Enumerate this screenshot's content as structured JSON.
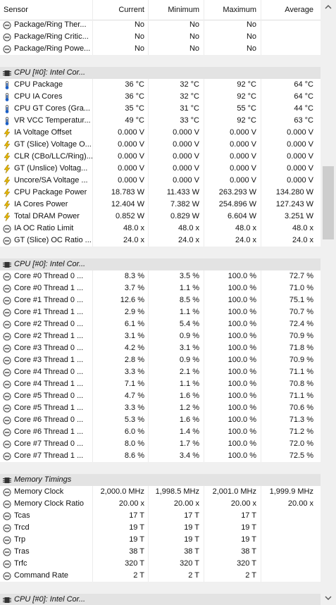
{
  "header": {
    "sensor": "Sensor",
    "current": "Current",
    "minimum": "Minimum",
    "maximum": "Maximum",
    "average": "Average"
  },
  "colors": {
    "section_bg": "#e3e3e3",
    "bolt": "#e8b800",
    "thermo": "#1a5fc8"
  },
  "rows": [
    {
      "type": "data",
      "icon": "circle",
      "name": "Package/Ring Ther...",
      "cur": "No",
      "min": "No",
      "max": "No",
      "avg": ""
    },
    {
      "type": "data",
      "icon": "circle",
      "name": "Package/Ring Critic...",
      "cur": "No",
      "min": "No",
      "max": "No",
      "avg": ""
    },
    {
      "type": "data",
      "icon": "circle",
      "name": "Package/Ring Powe...",
      "cur": "No",
      "min": "No",
      "max": "No",
      "avg": ""
    },
    {
      "type": "blank"
    },
    {
      "type": "section",
      "icon": "chip",
      "name": "CPU [#0]: Intel Cor..."
    },
    {
      "type": "data",
      "icon": "thermo",
      "name": "CPU Package",
      "cur": "36 °C",
      "min": "32 °C",
      "max": "92 °C",
      "avg": "64 °C"
    },
    {
      "type": "data",
      "icon": "thermo",
      "name": "CPU IA Cores",
      "cur": "36 °C",
      "min": "32 °C",
      "max": "92 °C",
      "avg": "64 °C"
    },
    {
      "type": "data",
      "icon": "thermo",
      "name": "CPU GT Cores (Gra...",
      "cur": "35 °C",
      "min": "31 °C",
      "max": "55 °C",
      "avg": "44 °C"
    },
    {
      "type": "data",
      "icon": "thermo",
      "name": "VR VCC Temperatur...",
      "cur": "49 °C",
      "min": "33 °C",
      "max": "92 °C",
      "avg": "63 °C"
    },
    {
      "type": "data",
      "icon": "bolt",
      "name": "IA Voltage Offset",
      "cur": "0.000 V",
      "min": "0.000 V",
      "max": "0.000 V",
      "avg": "0.000 V"
    },
    {
      "type": "data",
      "icon": "bolt",
      "name": "GT (Slice) Voltage O...",
      "cur": "0.000 V",
      "min": "0.000 V",
      "max": "0.000 V",
      "avg": "0.000 V"
    },
    {
      "type": "data",
      "icon": "bolt",
      "name": "CLR (CBo/LLC/Ring)...",
      "cur": "0.000 V",
      "min": "0.000 V",
      "max": "0.000 V",
      "avg": "0.000 V"
    },
    {
      "type": "data",
      "icon": "bolt",
      "name": "GT (Unslice) Voltag...",
      "cur": "0.000 V",
      "min": "0.000 V",
      "max": "0.000 V",
      "avg": "0.000 V"
    },
    {
      "type": "data",
      "icon": "bolt",
      "name": "Uncore/SA Voltage ...",
      "cur": "0.000 V",
      "min": "0.000 V",
      "max": "0.000 V",
      "avg": "0.000 V"
    },
    {
      "type": "data",
      "icon": "bolt",
      "name": "CPU Package Power",
      "cur": "18.783 W",
      "min": "11.433 W",
      "max": "263.293 W",
      "avg": "134.280 W"
    },
    {
      "type": "data",
      "icon": "bolt",
      "name": "IA Cores Power",
      "cur": "12.404 W",
      "min": "7.382 W",
      "max": "254.896 W",
      "avg": "127.243 W"
    },
    {
      "type": "data",
      "icon": "bolt",
      "name": "Total DRAM Power",
      "cur": "0.852 W",
      "min": "0.829 W",
      "max": "6.604 W",
      "avg": "3.251 W"
    },
    {
      "type": "data",
      "icon": "circle",
      "name": "IA OC Ratio Limit",
      "cur": "48.0 x",
      "min": "48.0 x",
      "max": "48.0 x",
      "avg": "48.0 x"
    },
    {
      "type": "data",
      "icon": "circle",
      "name": "GT (Slice) OC Ratio ...",
      "cur": "24.0 x",
      "min": "24.0 x",
      "max": "24.0 x",
      "avg": "24.0 x"
    },
    {
      "type": "blank"
    },
    {
      "type": "section",
      "icon": "chip",
      "name": "CPU [#0]: Intel Cor..."
    },
    {
      "type": "data",
      "icon": "circle",
      "name": "Core #0 Thread 0 ...",
      "cur": "8.3 %",
      "min": "3.5 %",
      "max": "100.0 %",
      "avg": "72.7 %"
    },
    {
      "type": "data",
      "icon": "circle",
      "name": "Core #0 Thread 1 ...",
      "cur": "3.7 %",
      "min": "1.1 %",
      "max": "100.0 %",
      "avg": "71.0 %"
    },
    {
      "type": "data",
      "icon": "circle",
      "name": "Core #1 Thread 0 ...",
      "cur": "12.6 %",
      "min": "8.5 %",
      "max": "100.0 %",
      "avg": "75.1 %"
    },
    {
      "type": "data",
      "icon": "circle",
      "name": "Core #1 Thread 1 ...",
      "cur": "2.9 %",
      "min": "1.1 %",
      "max": "100.0 %",
      "avg": "70.7 %"
    },
    {
      "type": "data",
      "icon": "circle",
      "name": "Core #2 Thread 0 ...",
      "cur": "6.1 %",
      "min": "5.4 %",
      "max": "100.0 %",
      "avg": "72.4 %"
    },
    {
      "type": "data",
      "icon": "circle",
      "name": "Core #2 Thread 1 ...",
      "cur": "3.1 %",
      "min": "0.9 %",
      "max": "100.0 %",
      "avg": "70.9 %"
    },
    {
      "type": "data",
      "icon": "circle",
      "name": "Core #3 Thread 0 ...",
      "cur": "4.2 %",
      "min": "3.1 %",
      "max": "100.0 %",
      "avg": "71.8 %"
    },
    {
      "type": "data",
      "icon": "circle",
      "name": "Core #3 Thread 1 ...",
      "cur": "2.8 %",
      "min": "0.9 %",
      "max": "100.0 %",
      "avg": "70.9 %"
    },
    {
      "type": "data",
      "icon": "circle",
      "name": "Core #4 Thread 0 ...",
      "cur": "3.3 %",
      "min": "2.1 %",
      "max": "100.0 %",
      "avg": "71.1 %"
    },
    {
      "type": "data",
      "icon": "circle",
      "name": "Core #4 Thread 1 ...",
      "cur": "7.1 %",
      "min": "1.1 %",
      "max": "100.0 %",
      "avg": "70.8 %"
    },
    {
      "type": "data",
      "icon": "circle",
      "name": "Core #5 Thread 0 ...",
      "cur": "4.7 %",
      "min": "1.6 %",
      "max": "100.0 %",
      "avg": "71.1 %"
    },
    {
      "type": "data",
      "icon": "circle",
      "name": "Core #5 Thread 1 ...",
      "cur": "3.3 %",
      "min": "1.2 %",
      "max": "100.0 %",
      "avg": "70.6 %"
    },
    {
      "type": "data",
      "icon": "circle",
      "name": "Core #6 Thread 0 ...",
      "cur": "5.3 %",
      "min": "1.6 %",
      "max": "100.0 %",
      "avg": "71.3 %"
    },
    {
      "type": "data",
      "icon": "circle",
      "name": "Core #6 Thread 1 ...",
      "cur": "6.0 %",
      "min": "1.4 %",
      "max": "100.0 %",
      "avg": "71.2 %"
    },
    {
      "type": "data",
      "icon": "circle",
      "name": "Core #7 Thread 0 ...",
      "cur": "8.0 %",
      "min": "1.7 %",
      "max": "100.0 %",
      "avg": "72.0 %"
    },
    {
      "type": "data",
      "icon": "circle",
      "name": "Core #7 Thread 1 ...",
      "cur": "8.6 %",
      "min": "3.4 %",
      "max": "100.0 %",
      "avg": "72.5 %"
    },
    {
      "type": "blank"
    },
    {
      "type": "section",
      "icon": "chip",
      "name": "Memory Timings"
    },
    {
      "type": "data",
      "icon": "circle",
      "name": "Memory Clock",
      "cur": "2,000.0 MHz",
      "min": "1,998.5 MHz",
      "max": "2,001.0 MHz",
      "avg": "1,999.9 MHz"
    },
    {
      "type": "data",
      "icon": "circle",
      "name": "Memory Clock Ratio",
      "cur": "20.00 x",
      "min": "20.00 x",
      "max": "20.00 x",
      "avg": "20.00 x"
    },
    {
      "type": "data",
      "icon": "circle",
      "name": "Tcas",
      "cur": "17 T",
      "min": "17 T",
      "max": "17 T",
      "avg": ""
    },
    {
      "type": "data",
      "icon": "circle",
      "name": "Trcd",
      "cur": "19 T",
      "min": "19 T",
      "max": "19 T",
      "avg": ""
    },
    {
      "type": "data",
      "icon": "circle",
      "name": "Trp",
      "cur": "19 T",
      "min": "19 T",
      "max": "19 T",
      "avg": ""
    },
    {
      "type": "data",
      "icon": "circle",
      "name": "Tras",
      "cur": "38 T",
      "min": "38 T",
      "max": "38 T",
      "avg": ""
    },
    {
      "type": "data",
      "icon": "circle",
      "name": "Trfc",
      "cur": "320 T",
      "min": "320 T",
      "max": "320 T",
      "avg": ""
    },
    {
      "type": "data",
      "icon": "circle",
      "name": "Command Rate",
      "cur": "2 T",
      "min": "2 T",
      "max": "2 T",
      "avg": ""
    },
    {
      "type": "blank"
    },
    {
      "type": "section",
      "icon": "chip",
      "name": "CPU [#0]: Intel Cor..."
    }
  ]
}
